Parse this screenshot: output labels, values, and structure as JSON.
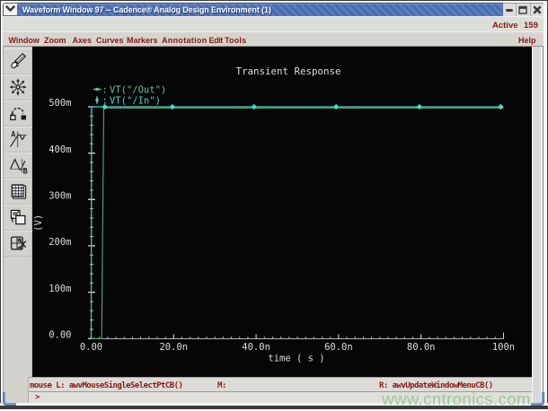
{
  "window": {
    "title": "Waveform Window 97 -- Cadence® Analog Design Environment (1)",
    "controls": [
      "window-menu",
      "minimize",
      "maximize",
      "close"
    ]
  },
  "active_row": {
    "label": "Active",
    "value": "159"
  },
  "menubar": {
    "items": [
      "Window",
      "Zoom",
      "Axes",
      "Curves",
      "Markers",
      "Annotation",
      "Edit",
      "Tools"
    ],
    "help": "Help"
  },
  "toolbar": {
    "icons": [
      "pen-icon",
      "zoom-fit-icon",
      "subwindow-swap-icon",
      "marker-a-icon",
      "marker-b-icon",
      "calculator-icon",
      "copy-subwindow-icon",
      "delete-subwindow-icon"
    ]
  },
  "statusbar": {
    "mouse_left": "mouse L: awvMouseSingleSelectPtCB()",
    "mouse_middle": "M:",
    "mouse_right": "R: awvUpdateWindowMenuCB()",
    "prompt": ">"
  },
  "watermark": "www.cntronics.com",
  "colors": {
    "titlebar_blue": "#4a6cae",
    "menu_text": "#8c1713",
    "plot_bg": "#060606",
    "trace_out_green": "#58a06d",
    "trace_in_cyan": "#47ccc2",
    "marker_cyan": "#3ee0d6",
    "axis_gray": "#b4b4b4",
    "plot_text": "#dcdcdc",
    "watermark_green": "#8dc78d"
  },
  "chart_data": {
    "type": "line",
    "title": "Transient Response",
    "xlabel": "time ( s )",
    "ylabel": "(V)",
    "x_unit": "ns",
    "y_unit": "mV",
    "xlim": [
      0,
      100
    ],
    "ylim": [
      0,
      500
    ],
    "x_ticks": [
      {
        "ns": 0,
        "label": "0.00"
      },
      {
        "ns": 20,
        "label": "20.0n"
      },
      {
        "ns": 40,
        "label": "40.0n"
      },
      {
        "ns": 60,
        "label": "60.0n"
      },
      {
        "ns": 80,
        "label": "80.0n"
      },
      {
        "ns": 100,
        "label": "100n"
      }
    ],
    "y_ticks": [
      {
        "mv": 0,
        "label": "0.00"
      },
      {
        "mv": 100,
        "label": "100m"
      },
      {
        "mv": 200,
        "label": "200m"
      },
      {
        "mv": 300,
        "label": "300m"
      },
      {
        "mv": 400,
        "label": "400m"
      },
      {
        "mv": 500,
        "label": "500m"
      }
    ],
    "x_minor_step": 2,
    "y_minor_step": 20,
    "legend": [
      {
        "name": "VT(\"/Out\")",
        "color": "#6fbe93",
        "sample": "h-line-dot"
      },
      {
        "name": "VT(\"/In\")",
        "color": "#53cfc6",
        "sample": "v-line-dot"
      }
    ],
    "series": [
      {
        "name": "VT(\"/Out\")",
        "color": "#539a69",
        "points": [
          [
            0,
            0
          ],
          [
            2.55,
            0
          ],
          [
            3.05,
            500
          ],
          [
            100,
            500
          ]
        ]
      },
      {
        "name": "VT(\"/In\")",
        "color": "#47ccc2",
        "marker": "diamond",
        "marker_color": "#3ee0d6",
        "points": [
          [
            0,
            0
          ],
          [
            0.1,
            500
          ],
          [
            100,
            500
          ]
        ],
        "marker_x": [
          3.3,
          19.7,
          39.5,
          59.4,
          79.6,
          99.3
        ]
      }
    ]
  }
}
